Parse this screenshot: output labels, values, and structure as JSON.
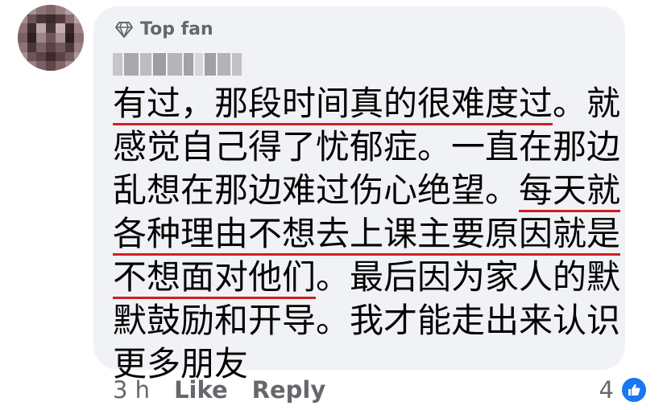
{
  "badge": {
    "label": "Top fan",
    "icon": "diamond-icon"
  },
  "author": {
    "name_blurred": true
  },
  "comment": {
    "lines": [
      {
        "segments": [
          {
            "text": "有过，那段时间真的很难度过",
            "underline": true
          },
          {
            "text": "。就",
            "underline": false
          }
        ]
      },
      {
        "segments": [
          {
            "text": "感觉自己得了忧郁症。一直在那边",
            "underline": false
          }
        ]
      },
      {
        "segments": [
          {
            "text": "乱想在那边难过伤心绝望。",
            "underline": false
          },
          {
            "text": "每天就",
            "underline": true
          }
        ]
      },
      {
        "segments": [
          {
            "text": "各种理由不想去上课主要原因就是",
            "underline": true
          }
        ]
      },
      {
        "segments": [
          {
            "text": "不想面对他们",
            "underline": true
          },
          {
            "text": "。最后因为家人的默",
            "underline": false
          }
        ]
      },
      {
        "segments": [
          {
            "text": "默鼓励和开导。我才能走出来认识",
            "underline": false
          }
        ]
      },
      {
        "segments": [
          {
            "text": "更多朋友",
            "underline": false
          }
        ]
      }
    ]
  },
  "actions": {
    "time": "3 h",
    "like": "Like",
    "reply": "Reply"
  },
  "reactions": {
    "count": "4",
    "icon": "thumbs-up-icon"
  },
  "colors": {
    "bubble": "#f0f2f5",
    "meta_text": "#65676b",
    "underline": "#d11f1f",
    "like_blue": "#1877f2"
  }
}
